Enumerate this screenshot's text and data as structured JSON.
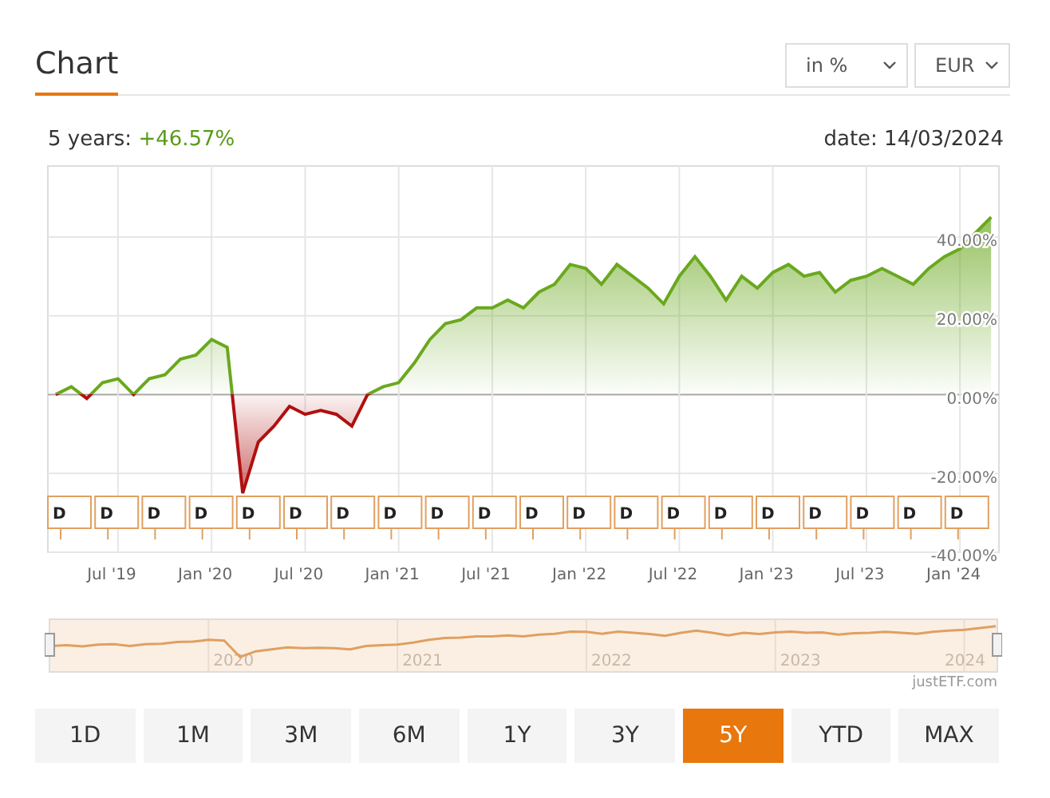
{
  "title": "Chart",
  "selects": [
    {
      "value": "in %"
    },
    {
      "value": "EUR"
    }
  ],
  "summary": {
    "label": "5 years:",
    "value": "+46.57%",
    "date": "date: 14/03/2024"
  },
  "chart": {
    "chart_data": {
      "type": "area",
      "categories": [
        null,
        null,
        null,
        null,
        "Jul '19",
        null,
        null,
        null,
        null,
        null,
        "Jan '20",
        null,
        null,
        null,
        null,
        null,
        "Jul '20",
        null,
        null,
        null,
        null,
        null,
        "Jan '21",
        null,
        null,
        null,
        null,
        null,
        "Jul '21",
        null,
        null,
        null,
        null,
        null,
        "Jan '22",
        null,
        null,
        null,
        null,
        null,
        "Jul '22",
        null,
        null,
        null,
        null,
        null,
        "Jan '23",
        null,
        null,
        null,
        null,
        null,
        "Jul '23",
        null,
        null,
        null,
        null,
        null,
        "Jan '24",
        null,
        null
      ],
      "series": [
        {
          "color": "#6aa81e",
          "values": [
            0,
            2,
            -1,
            3,
            4,
            0,
            4,
            5,
            9,
            10,
            14,
            12,
            -25,
            -12,
            -8,
            -3,
            -5,
            -4,
            -5,
            -8,
            0,
            2,
            3,
            8,
            14,
            18,
            19,
            22,
            22,
            24,
            22,
            26,
            28,
            33,
            32,
            28,
            33,
            30,
            27,
            23,
            30,
            35,
            30,
            24,
            30,
            27,
            31,
            33,
            30,
            31,
            26,
            29,
            30,
            32,
            30,
            28,
            32,
            35,
            37,
            41,
            45
          ]
        }
      ],
      "ylim": [
        -40,
        58
      ],
      "grid": true,
      "yticks": [
        {
          "value": 40,
          "label": "40.00%"
        },
        {
          "value": 20,
          "label": "20.00%"
        },
        {
          "value": 0,
          "label": "0.00%"
        },
        {
          "value": -20,
          "label": "-20.00%"
        },
        {
          "value": -40,
          "label": "-40.00%"
        }
      ]
    },
    "dividend_flags": [
      "D",
      "D",
      "D",
      "D",
      "D",
      "D",
      "D",
      "D",
      "D",
      "D",
      "D",
      "D",
      "D",
      "D",
      "D",
      "D",
      "D",
      "D",
      "D",
      "D"
    ]
  },
  "navigator": {
    "years": [
      "2020",
      "2021",
      "2022",
      "2023",
      "2024"
    ],
    "credit": "justETF.com"
  },
  "periods": [
    {
      "label": "1D",
      "selected": false
    },
    {
      "label": "1M",
      "selected": false
    },
    {
      "label": "3M",
      "selected": false
    },
    {
      "label": "6M",
      "selected": false
    },
    {
      "label": "1Y",
      "selected": false
    },
    {
      "label": "3Y",
      "selected": false
    },
    {
      "label": "5Y",
      "selected": true
    },
    {
      "label": "YTD",
      "selected": false
    },
    {
      "label": "MAX",
      "selected": false
    }
  ]
}
